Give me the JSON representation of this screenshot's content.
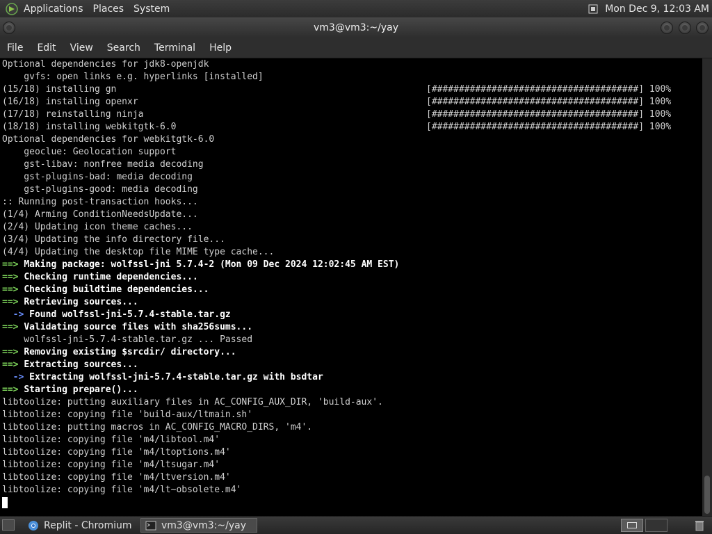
{
  "top_panel": {
    "menus": [
      "Applications",
      "Places",
      "System"
    ],
    "clock": "Mon Dec 9, 12:03 AM"
  },
  "window": {
    "title": "vm3@vm3:~/yay"
  },
  "menubar": {
    "items": [
      "File",
      "Edit",
      "View",
      "Search",
      "Terminal",
      "Help"
    ]
  },
  "terminal": {
    "lines": [
      {
        "text": "Optional dependencies for jdk8-openjdk"
      },
      {
        "text": "    gvfs: open links e.g. hyperlinks [installed]"
      },
      {
        "text": "(15/18) installing gn",
        "progress": "[######################################] 100%"
      },
      {
        "text": "(16/18) installing openxr",
        "progress": "[######################################] 100%"
      },
      {
        "text": "(17/18) reinstalling ninja",
        "progress": "[######################################] 100%"
      },
      {
        "text": "(18/18) installing webkitgtk-6.0",
        "progress": "[######################################] 100%"
      },
      {
        "text": "Optional dependencies for webkitgtk-6.0"
      },
      {
        "text": "    geoclue: Geolocation support"
      },
      {
        "text": "    gst-libav: nonfree media decoding"
      },
      {
        "text": "    gst-plugins-bad: media decoding"
      },
      {
        "text": "    gst-plugins-good: media decoding"
      },
      {
        "text": ":: Running post-transaction hooks..."
      },
      {
        "text": "(1/4) Arming ConditionNeedsUpdate..."
      },
      {
        "text": "(2/4) Updating icon theme caches..."
      },
      {
        "text": "(3/4) Updating the info directory file..."
      },
      {
        "text": "(4/4) Updating the desktop file MIME type cache..."
      },
      {
        "prefix": "==>",
        "bold": "Making package: wolfssl-jni 5.7.4-2 (Mon 09 Dec 2024 12:02:45 AM EST)"
      },
      {
        "prefix": "==>",
        "bold": "Checking runtime dependencies..."
      },
      {
        "prefix": "==>",
        "bold": "Checking buildtime dependencies..."
      },
      {
        "prefix": "==>",
        "bold": "Retrieving sources..."
      },
      {
        "sub": "  ->",
        "bold": "Found wolfssl-jni-5.7.4-stable.tar.gz"
      },
      {
        "prefix": "==>",
        "bold": "Validating source files with sha256sums..."
      },
      {
        "text": "    wolfssl-jni-5.7.4-stable.tar.gz ... Passed"
      },
      {
        "prefix": "==>",
        "bold": "Removing existing $srcdir/ directory..."
      },
      {
        "prefix": "==>",
        "bold": "Extracting sources..."
      },
      {
        "sub": "  ->",
        "bold": "Extracting wolfssl-jni-5.7.4-stable.tar.gz with bsdtar"
      },
      {
        "prefix": "==>",
        "bold": "Starting prepare()..."
      },
      {
        "text": "libtoolize: putting auxiliary files in AC_CONFIG_AUX_DIR, 'build-aux'."
      },
      {
        "text": "libtoolize: copying file 'build-aux/ltmain.sh'"
      },
      {
        "text": "libtoolize: putting macros in AC_CONFIG_MACRO_DIRS, 'm4'."
      },
      {
        "text": "libtoolize: copying file 'm4/libtool.m4'"
      },
      {
        "text": "libtoolize: copying file 'm4/ltoptions.m4'"
      },
      {
        "text": "libtoolize: copying file 'm4/ltsugar.m4'"
      },
      {
        "text": "libtoolize: copying file 'm4/ltversion.m4'"
      },
      {
        "text": "libtoolize: copying file 'm4/lt~obsolete.m4'"
      }
    ]
  },
  "taskbar": {
    "tasks": [
      {
        "label": "Replit - Chromium",
        "icon": "chromium-icon"
      },
      {
        "label": "vm3@vm3:~/yay",
        "icon": "terminal-icon"
      }
    ]
  },
  "colors": {
    "prefix_green": "#7dd35a",
    "arrow_blue": "#6a8fff",
    "terminal_bg": "#000000"
  }
}
